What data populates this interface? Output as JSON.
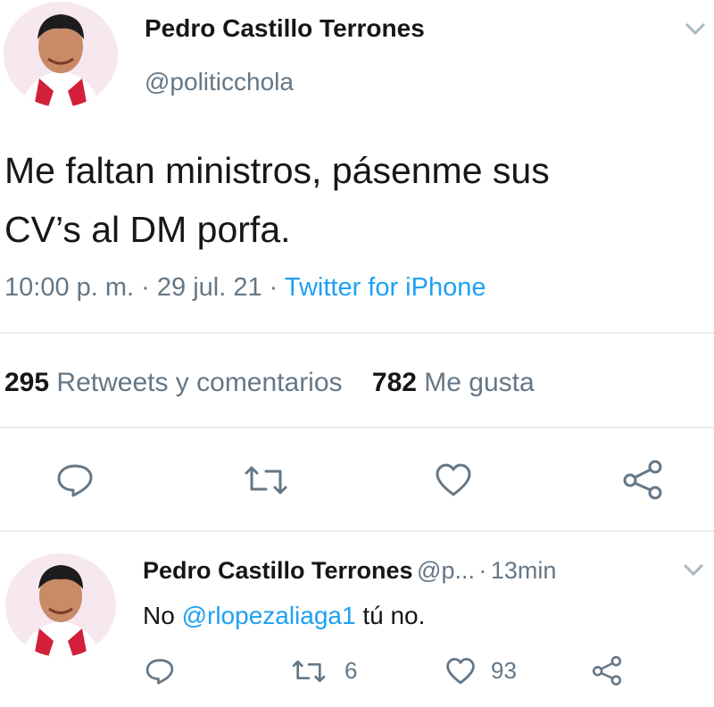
{
  "tweet": {
    "author_name": "Pedro Castillo Terrones",
    "author_handle": "@politicchola",
    "text_line1": "Me faltan ministros, pásenme sus",
    "text_line2": "CV’s al DM porfa.",
    "time": "10:00 p. m.",
    "date": "29 jul. 21",
    "separator": " · ",
    "source": "Twitter for iPhone",
    "retweets_count": "295",
    "retweets_label": "Retweets y comentarios",
    "likes_count": "782",
    "likes_label": "Me gusta",
    "icons": [
      "reply-icon",
      "retweet-icon",
      "like-icon",
      "share-icon",
      "chevron-down-icon"
    ]
  },
  "reply": {
    "author_name": "Pedro Castillo Terrones",
    "author_handle": "@p...",
    "time_sep": "·",
    "time": "13min",
    "text_before": "No ",
    "mention": "@rlopezaliaga1",
    "text_after": " tú no.",
    "retweet_count": "6",
    "like_count": "93"
  },
  "colors": {
    "text": "#14171a",
    "secondary": "#657786",
    "link": "#1da1f2",
    "divider": "#e6ecf0"
  }
}
